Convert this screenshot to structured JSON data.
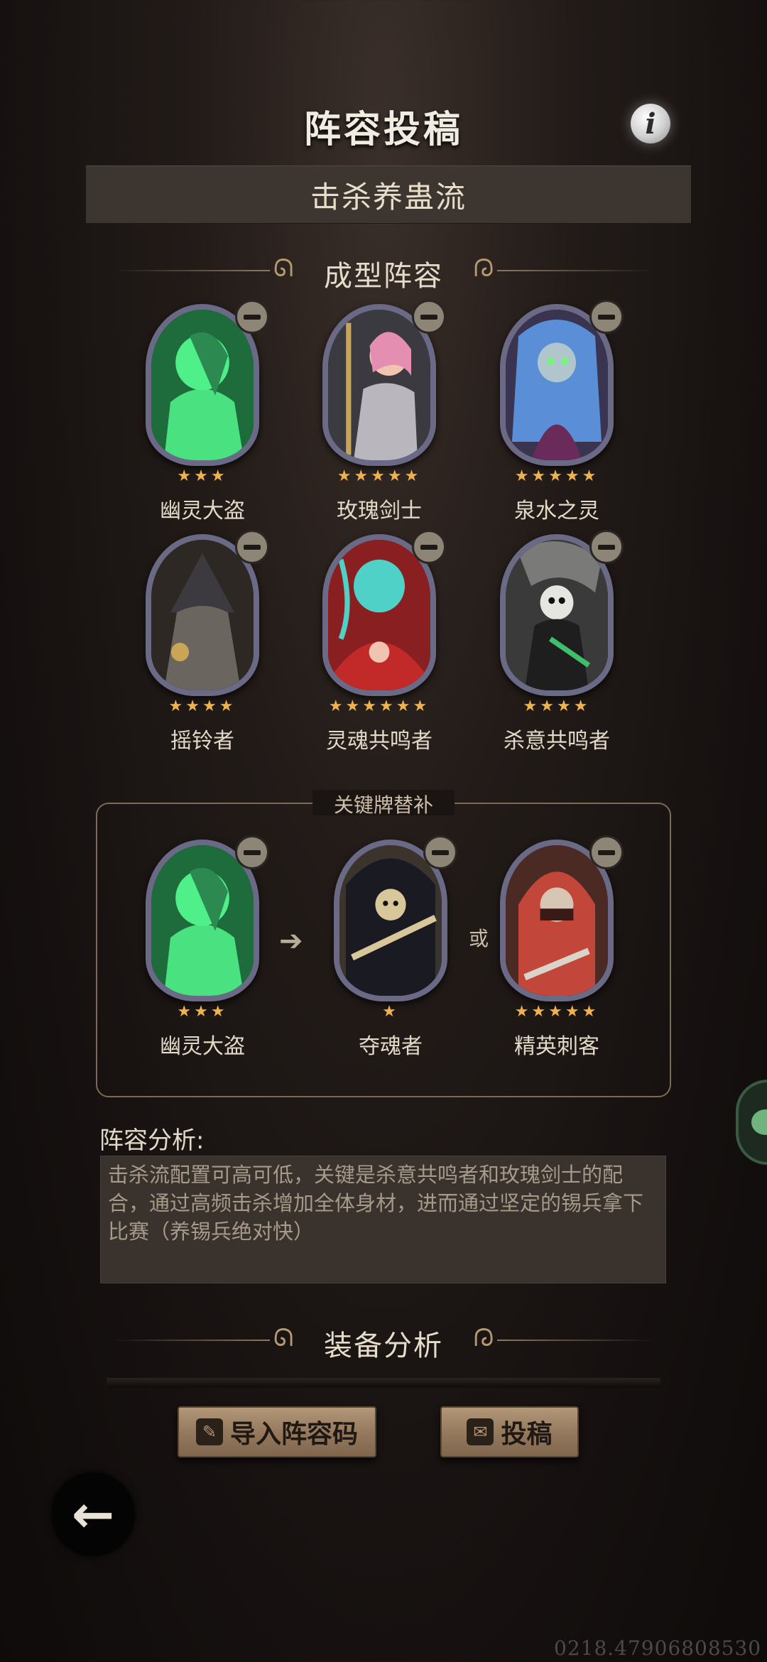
{
  "header": {
    "title": "阵容投稿",
    "info_icon": "info-icon"
  },
  "lineup_name": "击杀养蛊流",
  "core_section": {
    "title": "成型阵容",
    "cards": [
      {
        "name": "幽灵大盗",
        "stars": "★★★",
        "art": "ghost-thief",
        "bg": "#1e6b3b",
        "fg": "#4ff08a"
      },
      {
        "name": "玫瑰剑士",
        "stars": "★★★★★",
        "art": "rose-swordsman",
        "bg": "#3b3a40",
        "fg": "#e48fb2"
      },
      {
        "name": "泉水之灵",
        "stars": "★★★★★",
        "art": "spring-spirit",
        "bg": "#3b3450",
        "fg": "#5a8fd8"
      },
      {
        "name": "摇铃者",
        "stars": "★★★★",
        "art": "bell-ringer",
        "bg": "#2d2824",
        "fg": "#6b655f"
      },
      {
        "name": "灵魂共鸣者",
        "stars": "★★★★★★",
        "art": "soul-resonator",
        "bg": "#8a1f22",
        "fg": "#4fd1c8"
      },
      {
        "name": "杀意共鸣者",
        "stars": "★★★★",
        "art": "killing-resonator",
        "bg": "#3a3a3a",
        "fg": "#e6e6e0"
      }
    ]
  },
  "substitute_section": {
    "title": "关键牌替补",
    "or_label": "或",
    "cards": [
      {
        "name": "幽灵大盗",
        "stars": "★★★",
        "art": "ghost-thief",
        "bg": "#1e6b3b",
        "fg": "#4ff08a"
      },
      {
        "name": "夺魂者",
        "stars": "★",
        "art": "soul-reaper",
        "bg": "#3a342c",
        "fg": "#d8c79a"
      },
      {
        "name": "精英刺客",
        "stars": "★★★★★",
        "art": "elite-assassin",
        "bg": "#4a2a22",
        "fg": "#c2463a"
      }
    ]
  },
  "analysis": {
    "label": "阵容分析:",
    "text": "击杀流配置可高可低，关键是杀意共鸣者和玫瑰剑士的配合，通过高频击杀增加全体身材，进而通过坚定的锡兵拿下比赛（养锡兵绝对快）"
  },
  "equipment_section": {
    "title": "装备分析"
  },
  "actions": {
    "import_label": "导入阵容码",
    "submit_label": "投稿"
  },
  "watermark": "0218.47906808530",
  "colors": {
    "star": "#f0b24a",
    "plank": "#957a5e",
    "frame": "#6a6a86"
  }
}
